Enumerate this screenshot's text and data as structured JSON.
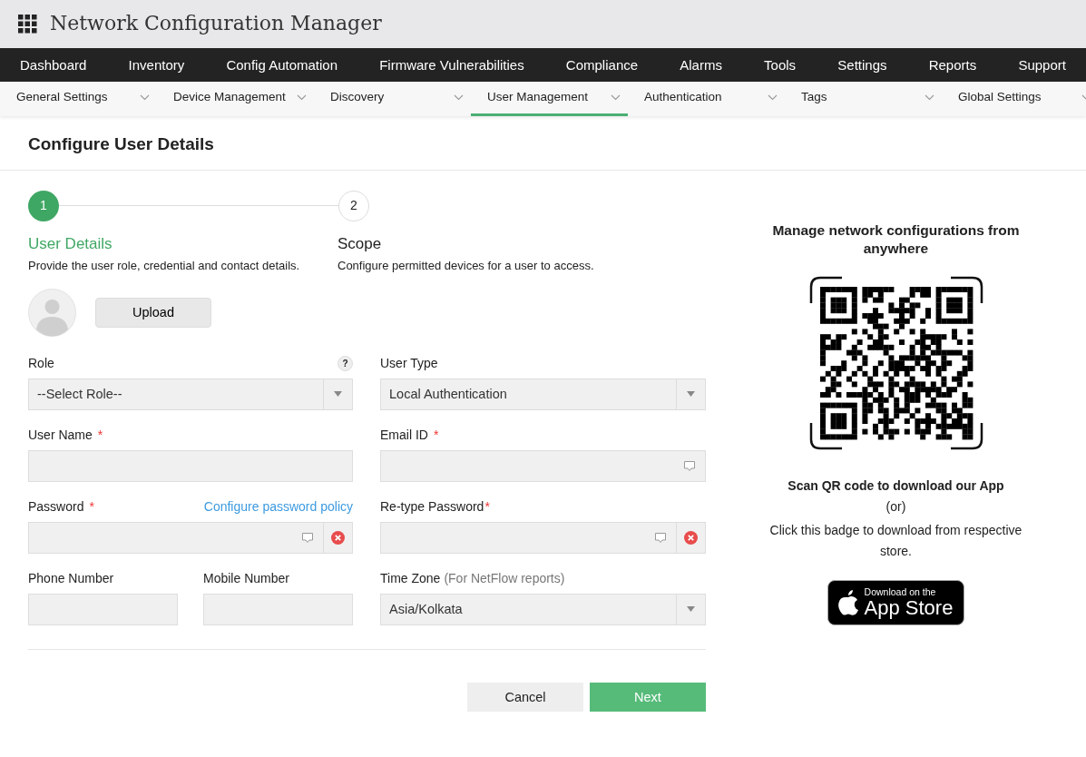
{
  "app_title": "Network Configuration Manager",
  "main_nav": [
    {
      "label": "Dashboard"
    },
    {
      "label": "Inventory"
    },
    {
      "label": "Config Automation"
    },
    {
      "label": "Firmware Vulnerabilities"
    },
    {
      "label": "Compliance"
    },
    {
      "label": "Alarms"
    },
    {
      "label": "Tools"
    },
    {
      "label": "Settings"
    },
    {
      "label": "Reports"
    },
    {
      "label": "Support"
    }
  ],
  "sub_nav": [
    {
      "label": "General Settings",
      "selected": false
    },
    {
      "label": "Device Management",
      "selected": false
    },
    {
      "label": "Discovery",
      "selected": false
    },
    {
      "label": "User Management",
      "selected": true
    },
    {
      "label": "Authentication",
      "selected": false
    },
    {
      "label": "Tags",
      "selected": false
    },
    {
      "label": "Global Settings",
      "selected": false
    }
  ],
  "page_title": "Configure User Details",
  "steps": [
    {
      "number": "1",
      "title": "User Details",
      "description": "Provide the user role, credential and contact details.",
      "selected": true
    },
    {
      "number": "2",
      "title": "Scope",
      "description": "Configure permitted devices for a user to access.",
      "selected": false
    }
  ],
  "upload_button": "Upload",
  "form_rows": [
    [
      {
        "kind": "select",
        "label": "Role",
        "help": "?",
        "value": "--Select Role--"
      },
      {
        "kind": "select",
        "label": "User Type",
        "value": "Local Authentication"
      }
    ],
    [
      {
        "kind": "text",
        "label": "User Name",
        "required_mark": "*"
      },
      {
        "kind": "text",
        "label": "Email ID",
        "required_mark": "*",
        "key_icon": true
      }
    ],
    [
      {
        "kind": "secret",
        "label": "Password",
        "required_mark": "*",
        "link": "Configure password policy",
        "key_icon": true,
        "clear": true
      },
      {
        "kind": "secret",
        "label": "Re-type Password",
        "required_mark": "*",
        "key_icon": true,
        "clear": true
      }
    ],
    [
      {
        "kind": "group",
        "fields": [
          {
            "kind": "text",
            "label": "Phone Number"
          },
          {
            "kind": "text",
            "label": "Mobile Number"
          }
        ]
      },
      {
        "kind": "select",
        "label": "Time Zone",
        "note": "(For NetFlow reports)",
        "value": "Asia/Kolkata"
      }
    ]
  ],
  "buttons": [
    {
      "kind": "secondary",
      "label": "Cancel"
    },
    {
      "kind": "primary",
      "label": "Next"
    }
  ],
  "app_panel": {
    "heading": "Manage network configurations from anywhere",
    "scan_text": "Scan QR code to download our App",
    "or_text": "(or)",
    "badge_text": "Click this badge to download from respective store.",
    "store_badge": {
      "small": "Download on the",
      "large": "App Store"
    }
  }
}
